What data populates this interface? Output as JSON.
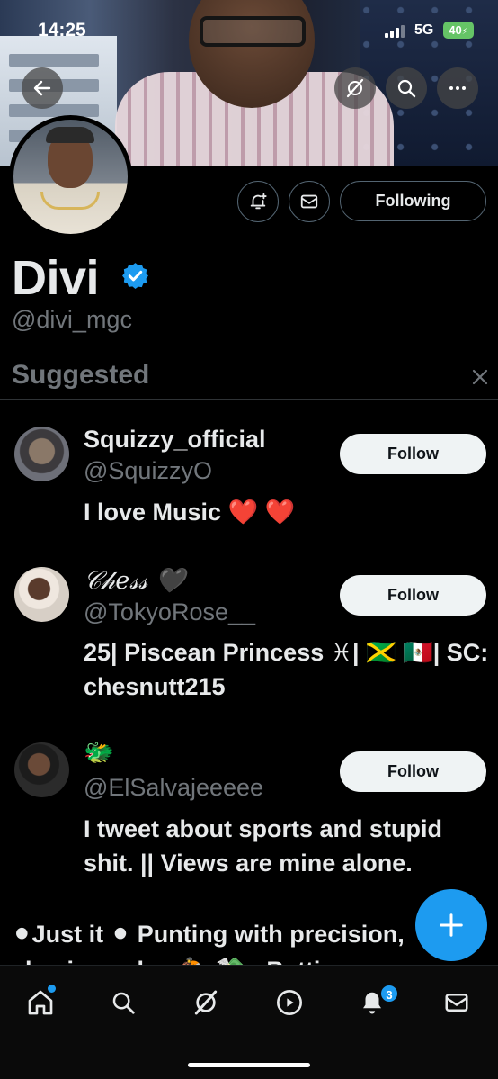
{
  "status_bar": {
    "time": "14:25",
    "network": "5G",
    "battery": "40"
  },
  "profile": {
    "name": "Divi",
    "handle": "@divi_mgc",
    "following_label": "Following"
  },
  "suggested": {
    "title": "Suggested",
    "accounts": [
      {
        "name": "Squizzy_official",
        "handle": "@SquizzyO",
        "bio": "I love Music ❤️ ❤️",
        "follow_label": "Follow"
      },
      {
        "name": "𝒞𝒽𝑒𝓈𝓈 🖤",
        "handle": "@TokyoRose__",
        "bio": "25| Piscean Princess ♓| 🇯🇲 🇲🇽| SC: chesnutt215",
        "follow_label": "Follow"
      },
      {
        "name": "🐲",
        "handle": "@ElSalvajeeeee",
        "bio": "I tweet about sports and stupid shit. || Views are mine alone.",
        "follow_label": "Follow"
      }
    ],
    "truncated_bio": "⚫Just it ⚫ Punting with precision, chasing value 🏇 💸 . Betting"
  },
  "tab_bar": {
    "notification_count": "3"
  },
  "colors": {
    "accent": "#1d9bf0",
    "muted": "#71767b",
    "text": "#e7e9ea"
  }
}
